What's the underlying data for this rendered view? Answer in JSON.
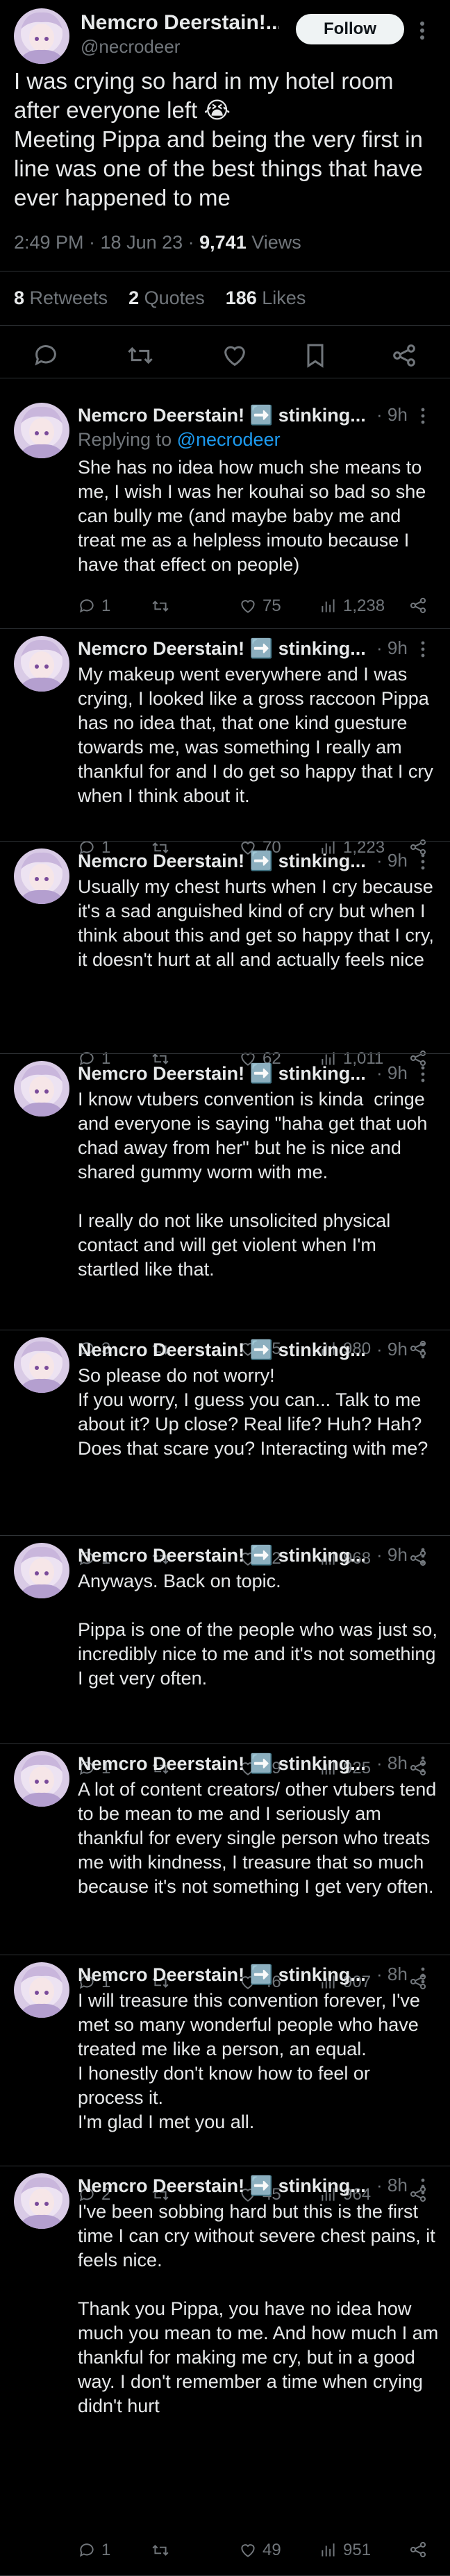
{
  "main": {
    "author_name": "Nemcro Deerstain!...",
    "handle": "@necrodeer",
    "follow_label": "Follow",
    "text": "I was crying so hard in my hotel room after everyone left 😭\nMeeting Pippa and being the very first in line was one of the best things that have ever happened to me",
    "timestamp": "2:49 PM · 18 Jun 23 · ",
    "views_count": "9,741",
    "views_label": " Views",
    "retweets_count": "8",
    "retweets_label": " Retweets",
    "quotes_count": "2",
    "quotes_label": " Quotes",
    "likes_count": "186",
    "likes_label": " Likes"
  },
  "replies": [
    {
      "name": "Nemcro Deerstain! ➡️ stinking...",
      "time": "· 9h",
      "replying_prefix": "Replying to ",
      "replying_handle": "@necrodeer",
      "text": "She has no idea how much she means to me, I wish I was her kouhai so bad so she can bully me (and maybe baby me and treat me as a helpless imouto because I have that effect on people)",
      "replies": "1",
      "retweets": "",
      "likes": "75",
      "views": "1,238"
    },
    {
      "name": "Nemcro Deerstain! ➡️ stinking...",
      "time": "· 9h",
      "text": "My makeup went everywhere and I was crying, I looked like a gross raccoon Pippa has no idea that, that one kind guesture towards me, was something I really am thankful for and I do get so happy that I cry when I think about it.",
      "replies": "1",
      "retweets": "",
      "likes": "70",
      "views": "1,223"
    },
    {
      "name": "Nemcro Deerstain! ➡️ stinking...",
      "time": "· 9h",
      "text": "Usually my chest hurts when I cry because it's a sad anguished kind of cry but when I think about this and get so happy that I cry, it doesn't hurt at all and actually feels nice",
      "replies": "1",
      "retweets": "",
      "likes": "62",
      "views": "1,011"
    },
    {
      "name": "Nemcro Deerstain! ➡️ stinking...",
      "time": "· 9h",
      "text": "I know vtubers convention is kinda  cringe and everyone is saying \"haha get that uoh chad away from her\" but he is nice and shared gummy worm with me.\n\nI really do not like unsolicited physical contact and will get violent when I'm startled like that.",
      "replies": "3",
      "retweets": "",
      "likes": "55",
      "views": "980"
    },
    {
      "name": "Nemcro Deerstain! ➡️ stinking...",
      "time": "· 9h",
      "text": "So please do not worry!\nIf you worry, I guess you can... Talk to me about it? Up close? Real life? Huh? Hah? Does that scare you? Interacting with me?",
      "replies": "1",
      "retweets": "",
      "likes": "52",
      "views": "968"
    },
    {
      "name": "Nemcro Deerstain! ➡️ stinking...",
      "time": "· 9h",
      "text": "Anyways. Back on topic.\n\nPippa is one of the people who was just so, incredibly nice to me and it's not something I get very often.",
      "replies": "1",
      "retweets": "",
      "likes": "49",
      "views": "925"
    },
    {
      "name": "Nemcro Deerstain! ➡️ stinking...",
      "time": "· 8h",
      "text": "A lot of content creators/ other vtubers tend to be mean to me and I seriously am thankful for every single person who treats me with kindness, I treasure that so much because it's not something I get very often.",
      "replies": "1",
      "retweets": "",
      "likes": "46",
      "views": "907"
    },
    {
      "name": "Nemcro Deerstain! ➡️ stinking...",
      "time": "· 8h",
      "text": "I will treasure this convention forever, I've met so many wonderful people who have treated me like a person, an equal.\nI honestly don't know how to feel or process it.\nI'm glad I met you all.",
      "replies": "2",
      "retweets": "",
      "likes": "45",
      "views": "964"
    },
    {
      "name": "Nemcro Deerstain! ➡️ stinking...",
      "time": "· 8h",
      "text": "I've been sobbing hard but this is the first time I can cry without severe chest pains, it feels nice.\n\nThank you Pippa, you have no idea how much you mean to me. And how much I am thankful for making me cry, but in a good way. I don't remember a time when crying didn't hurt",
      "replies": "1",
      "retweets": "",
      "likes": "49",
      "views": "951"
    }
  ],
  "icons": {
    "reply": "speech-bubble-icon",
    "retweet": "retweet-arrows-icon",
    "like": "heart-icon",
    "views": "bar-chart-icon",
    "bookmark": "bookmark-icon",
    "share": "share-icon",
    "more": "three-dots-icon"
  },
  "colors": {
    "background": "#000000",
    "text": "#e7e9ea",
    "muted": "#71767b",
    "link": "#1d9bf0",
    "divider": "#2f3336",
    "follow_bg": "#eff3f4"
  }
}
